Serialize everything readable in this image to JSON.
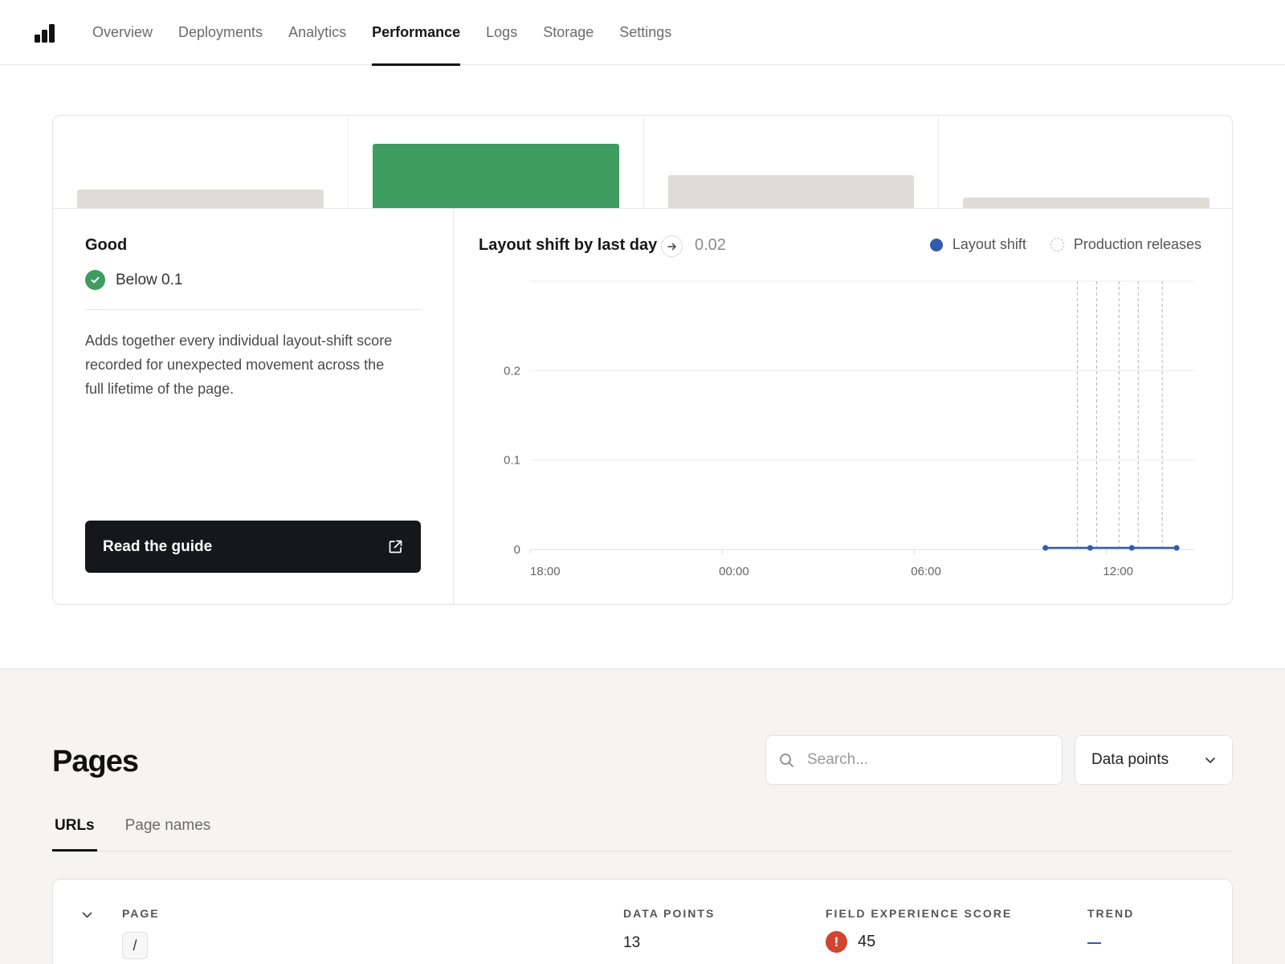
{
  "nav": {
    "logo_icon": "bar-chart-logo-icon",
    "tabs": [
      {
        "label": "Overview",
        "active": false
      },
      {
        "label": "Deployments",
        "active": false
      },
      {
        "label": "Analytics",
        "active": false
      },
      {
        "label": "Performance",
        "active": true
      },
      {
        "label": "Logs",
        "active": false
      },
      {
        "label": "Storage",
        "active": false
      },
      {
        "label": "Settings",
        "active": false
      }
    ]
  },
  "distribution": {
    "bars": [
      0.29,
      1.0,
      0.51,
      0.16
    ],
    "highlight_index": 1,
    "colors": {
      "default": "#dedcd6",
      "highlight": "#3e9c60"
    }
  },
  "metric": {
    "status_title": "Good",
    "threshold_label": "Below 0.1",
    "status_icon": "check-circle-icon",
    "description": "Adds together every individual layout-shift score recorded for unexpected movement across the full lifetime of the page.",
    "guide_button": "Read the guide",
    "guide_icon": "external-link-icon"
  },
  "chart": {
    "title": "Layout shift by last day",
    "value": "0.02",
    "legend": {
      "series": "Layout shift",
      "releases": "Production releases"
    },
    "colors": {
      "series": "#2f5cad"
    }
  },
  "chart_data": {
    "type": "line",
    "xlabel": "",
    "ylabel": "",
    "x_ticks": [
      "18:00",
      "00:00",
      "06:00",
      "12:00"
    ],
    "y_ticks": [
      "0",
      "0.1",
      "0.2"
    ],
    "ylim": [
      0,
      0.3
    ],
    "x_range_hours": [
      0,
      20.75
    ],
    "series": [
      {
        "x_hours": [
          16.1,
          17.5,
          18.8,
          20.2
        ],
        "values": [
          0,
          0,
          0,
          0
        ]
      }
    ],
    "release_markers_hours": [
      17.1,
      17.7,
      18.4,
      19.0,
      19.75
    ],
    "grid": true
  },
  "pages": {
    "title": "Pages",
    "search_placeholder": "Search...",
    "search_icon": "search-icon",
    "sort_select": "Data points",
    "subtabs": [
      {
        "label": "URLs",
        "active": true
      },
      {
        "label": "Page names",
        "active": false
      }
    ],
    "columns": [
      "PAGE",
      "DATA POINTS",
      "FIELD EXPERIENCE SCORE",
      "TREND"
    ],
    "rows": [
      {
        "page": "/",
        "data_points": "13",
        "score": "45",
        "score_status": "poor",
        "trend": "flat"
      }
    ]
  }
}
